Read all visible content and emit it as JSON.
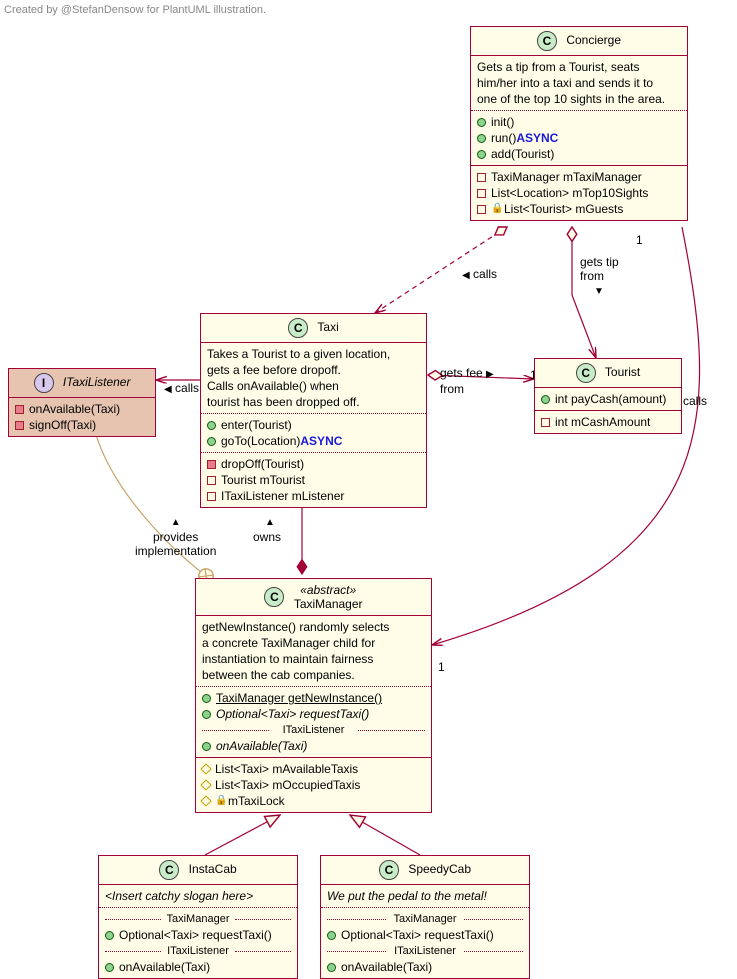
{
  "caption": "Created by @StefanDensow for PlantUML illustration.",
  "concierge": {
    "name": "Concierge",
    "desc1": "Gets a tip from a Tourist, seats",
    "desc2": "him/her into a taxi and sends it to",
    "desc3": "one of the top 10 sights in the area.",
    "m1": "init()",
    "m2a": "run() ",
    "m2b": "ASYNC",
    "m3": "add(Tourist)",
    "f1": "TaxiManager mTaxiManager",
    "f2": "List<Location> mTop10Sights",
    "f3": "List<Tourist> mGuests"
  },
  "taxi": {
    "name": "Taxi",
    "d1": "Takes a Tourist to a given location,",
    "d2": "gets a fee before dropoff.",
    "d3": "Calls onAvailable() when",
    "d4": "tourist has been dropped off.",
    "m1": "enter(Tourist)",
    "m2a": "goTo(Location) ",
    "m2b": "ASYNC",
    "p1": "dropOff(Tourist)",
    "p2": "Tourist mTourist",
    "p3": "ITaxiListener mListener"
  },
  "itaxi": {
    "name": "ITaxiListener",
    "m1": "onAvailable(Taxi)",
    "m2": "signOff(Taxi)"
  },
  "tourist": {
    "name": "Tourist",
    "m1": "int payCash(amount)",
    "f1": "int mCashAmount"
  },
  "taximgr": {
    "stereo": "«abstract»",
    "name": "TaxiManager",
    "d1": "getNewInstance() randomly selects",
    "d2": "a concrete TaxiManager child for",
    "d3": "instantiation to maintain fairness",
    "d4": "between the cab companies.",
    "m1": "TaxiManager getNewInstance()",
    "m2": "Optional<Taxi> requestTaxi()",
    "sep1": "ITaxiListener",
    "m3": "onAvailable(Taxi)",
    "f1": "List<Taxi> mAvailableTaxis",
    "f2": "List<Taxi> mOccupiedTaxis",
    "f3": "mTaxiLock"
  },
  "instacab": {
    "name": "InstaCab",
    "slogan": "<Insert catchy slogan here>",
    "sep1": "TaxiManager",
    "m1": "Optional<Taxi> requestTaxi()",
    "sep2": "ITaxiListener",
    "m2": "onAvailable(Taxi)"
  },
  "speedycab": {
    "name": "SpeedyCab",
    "slogan": "We put the pedal to the metal!",
    "sep1": "TaxiManager",
    "m1": "Optional<Taxi> requestTaxi()",
    "sep2": "ITaxiListener",
    "m2": "onAvailable(Taxi)"
  },
  "edges": {
    "calls": "calls",
    "getsTip1": "gets tip",
    "getsTip2": "from",
    "getsFee1": "gets fee",
    "getsFee2": "from",
    "provides1": "provides",
    "provides2": "implementation",
    "owns": "owns",
    "one_a": "1",
    "one_b": "1",
    "one_c": "1"
  }
}
